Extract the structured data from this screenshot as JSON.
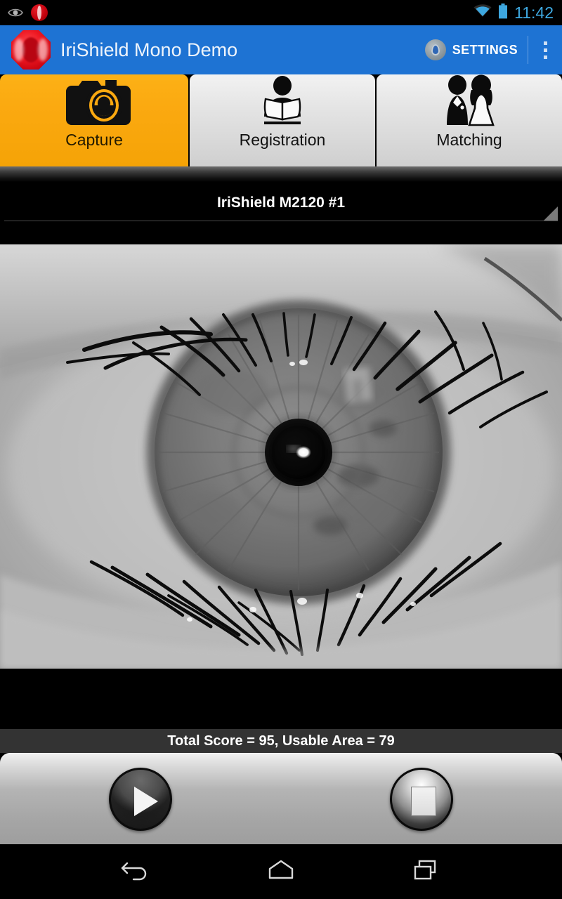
{
  "status_bar": {
    "icons": [
      "eye-icon",
      "irishield-notification-icon",
      "wifi-icon",
      "battery-icon"
    ],
    "time": "11:42",
    "time_color": "#3ea8e0"
  },
  "action_bar": {
    "app_title": "IriShield Mono Demo",
    "background_color": "#1e73d3",
    "logo_icon": "irishield-logo-icon",
    "settings_label": "SETTINGS",
    "settings_icon": "settings-gear-icon",
    "overflow_icon": "overflow-menu-icon"
  },
  "tabs": [
    {
      "label": "Capture",
      "icon": "camera-icon",
      "selected": true,
      "color": "#fba910"
    },
    {
      "label": "Registration",
      "icon": "person-reading-icon",
      "selected": false,
      "color": "#e3e3e3"
    },
    {
      "label": "Matching",
      "icon": "bride-groom-icon",
      "selected": false,
      "color": "#e3e3e3"
    }
  ],
  "device_spinner": {
    "selected": "IriShield M2120 #1",
    "dropdown_icon": "spinner-triangle-icon"
  },
  "preview": {
    "alt": "grayscale-iris-capture-image"
  },
  "score_bar": {
    "text": "Total Score = 95, Usable Area = 79",
    "total_score": 95,
    "usable_area": 79,
    "background_color": "#333333"
  },
  "controls": {
    "start_label": "",
    "start_icon": "play-icon",
    "stop_label": "",
    "stop_icon": "stop-icon"
  },
  "navigation_bar": {
    "back_icon": "back-icon",
    "home_icon": "home-icon",
    "recents_icon": "recents-icon"
  }
}
